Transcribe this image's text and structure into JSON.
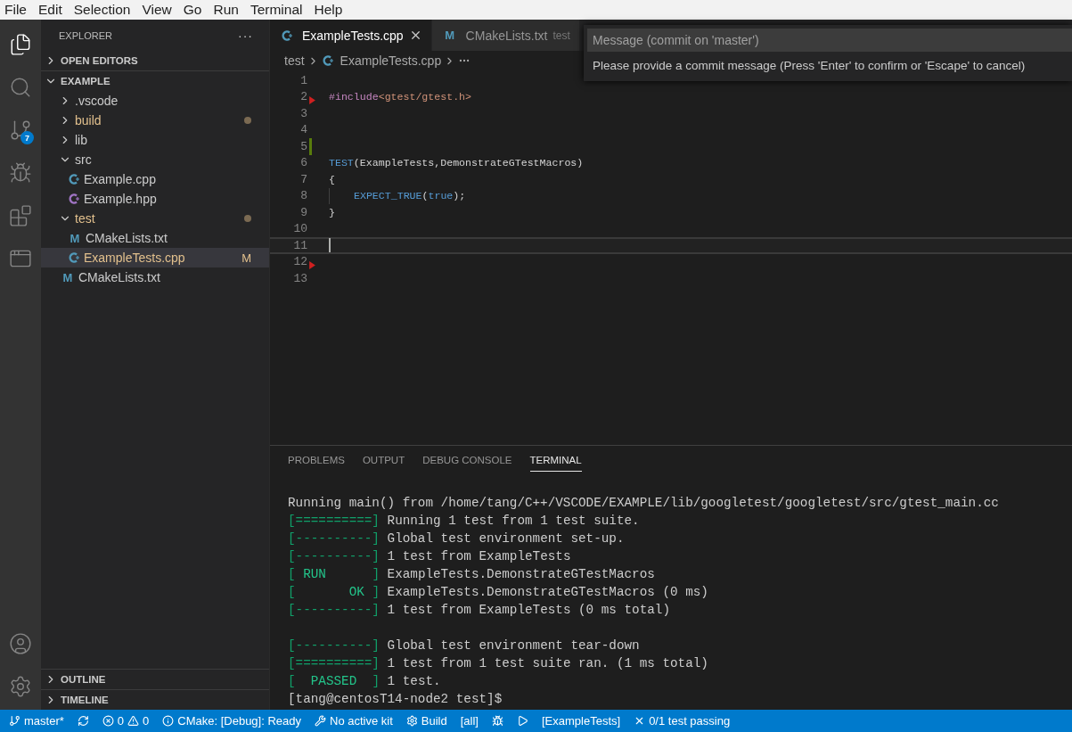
{
  "menu_bar": [
    "File",
    "Edit",
    "Selection",
    "View",
    "Go",
    "Run",
    "Terminal",
    "Help"
  ],
  "activity_bar": {
    "top": [
      {
        "kind": "files",
        "selected": true
      },
      {
        "kind": "search",
        "selected": false
      },
      {
        "kind": "source-control",
        "selected": false,
        "badge": "7"
      },
      {
        "kind": "run",
        "selected": false
      },
      {
        "kind": "extensions",
        "selected": false
      },
      {
        "kind": "remote",
        "selected": false
      }
    ],
    "bottom": [
      {
        "kind": "account",
        "selected": false
      },
      {
        "kind": "settings",
        "selected": false
      }
    ]
  },
  "sidebar": {
    "title": "EXPLORER",
    "more": "···",
    "sections": [
      {
        "label": "OPEN EDITORS",
        "expanded": false
      }
    ],
    "folder": {
      "label": "EXAMPLE",
      "expanded": true,
      "items": [
        {
          "kind": "folder",
          "label": ".vscode",
          "expanded": false,
          "modified": false,
          "selected": false
        },
        {
          "kind": "folder",
          "label": "build",
          "expanded": false,
          "modified": true,
          "selected": false
        },
        {
          "kind": "folder",
          "label": "lib",
          "expanded": false,
          "modified": false,
          "selected": false
        },
        {
          "kind": "folder",
          "label": "src",
          "expanded": true,
          "modified": false,
          "selected": false,
          "children": [
            {
              "kind": "cpp",
              "label": "Example.cpp",
              "modified": false,
              "selected": false
            },
            {
              "kind": "hpp",
              "label": "Example.hpp",
              "modified": false,
              "selected": false
            }
          ]
        },
        {
          "kind": "folder",
          "label": "test",
          "expanded": true,
          "modified": true,
          "selected": false,
          "children": [
            {
              "kind": "cmake",
              "glyph": "M",
              "label": "CMakeLists.txt",
              "modified": false,
              "selected": false
            },
            {
              "kind": "cpp",
              "label": "ExampleTests.cpp",
              "modified": true,
              "badge": "M",
              "selected": true
            }
          ]
        },
        {
          "kind": "cmake",
          "glyph": "M",
          "label": "CMakeLists.txt",
          "modified": false,
          "selected": false
        }
      ]
    },
    "bottom_sections": [
      {
        "label": "OUTLINE",
        "expanded": false
      },
      {
        "label": "TIMELINE",
        "expanded": false
      }
    ]
  },
  "editor": {
    "tabs": [
      {
        "kind": "cpp",
        "label": "ExampleTests.cpp",
        "selected": true
      },
      {
        "kind": "cmake",
        "glyph": "M",
        "label": "CMakeLists.txt",
        "description": "test",
        "selected": false
      }
    ],
    "breadcrumb": {
      "folder": "test",
      "file": "ExampleTests.cpp"
    },
    "code": {
      "lines": [
        {
          "number": "1",
          "error": false,
          "modified": false,
          "current": false,
          "indented": false
        },
        {
          "number": "2",
          "tokens": [
            {
              "kind": "directive",
              "text": "#include"
            },
            {
              "kind": "string",
              "text": "<gtest/gtest.h>"
            }
          ],
          "error": true,
          "modified": false,
          "current": false,
          "indented": false
        },
        {
          "number": "3",
          "error": false,
          "modified": false,
          "current": false,
          "indented": false
        },
        {
          "number": "4",
          "error": false,
          "modified": false,
          "current": false,
          "indented": false
        },
        {
          "number": "5",
          "error": false,
          "modified": true,
          "current": false,
          "indented": false
        },
        {
          "number": "6",
          "tokens": [
            {
              "kind": "macro",
              "text": "TEST"
            },
            {
              "kind": "plain",
              "text": "(ExampleTests,DemonstrateGTestMacros)"
            }
          ],
          "error": false,
          "modified": false,
          "current": false,
          "indented": false
        },
        {
          "number": "7",
          "tokens": [
            {
              "kind": "plain",
              "text": "{"
            }
          ],
          "error": false,
          "modified": false,
          "current": false,
          "indented": false
        },
        {
          "number": "8",
          "tokens": [
            {
              "kind": "macro",
              "text": "EXPECT_TRUE"
            },
            {
              "kind": "plain",
              "text": "("
            },
            {
              "kind": "keyword",
              "text": "true"
            },
            {
              "kind": "plain",
              "text": ");"
            }
          ],
          "error": false,
          "modified": false,
          "current": false,
          "indented": true
        },
        {
          "number": "9",
          "tokens": [
            {
              "kind": "plain",
              "text": "}"
            }
          ],
          "error": false,
          "modified": false,
          "current": false,
          "indented": false
        },
        {
          "number": "10",
          "error": false,
          "modified": false,
          "current": false,
          "indented": false
        },
        {
          "number": "11",
          "error": false,
          "modified": false,
          "current": true,
          "indented": false
        },
        {
          "number": "12",
          "error": true,
          "modified": false,
          "current": false,
          "indented": false
        },
        {
          "number": "13",
          "error": false,
          "modified": false,
          "current": false,
          "indented": false
        }
      ]
    }
  },
  "quick_input": {
    "placeholder": "Message (commit on 'master')",
    "message": "Please provide a commit message (Press 'Enter' to confirm or 'Escape' to cancel)"
  },
  "panel": {
    "tabs": [
      {
        "label": "PROBLEMS",
        "selected": false
      },
      {
        "label": "OUTPUT",
        "selected": false
      },
      {
        "label": "DEBUG CONSOLE",
        "selected": false
      },
      {
        "label": "TERMINAL",
        "selected": true
      }
    ],
    "terminal": [
      {
        "kind": "output",
        "segments": [
          {
            "kind": "text",
            "text": "Running main() from /home/tang/C++/VSCODE/EXAMPLE/lib/googletest/googletest/src/gtest_main.cc"
          }
        ]
      },
      {
        "kind": "output",
        "segments": [
          {
            "kind": "bracket",
            "text": "[==========]"
          },
          {
            "kind": "text",
            "text": " Running 1 test from 1 test suite."
          }
        ]
      },
      {
        "kind": "output",
        "segments": [
          {
            "kind": "bracket",
            "text": "[----------]"
          },
          {
            "kind": "text",
            "text": " Global test environment set-up."
          }
        ]
      },
      {
        "kind": "output",
        "segments": [
          {
            "kind": "bracket",
            "text": "[----------]"
          },
          {
            "kind": "text",
            "text": " 1 test from ExampleTests"
          }
        ]
      },
      {
        "kind": "output",
        "segments": [
          {
            "kind": "bracket",
            "text": "["
          },
          {
            "kind": "status",
            "text": " RUN      "
          },
          {
            "kind": "bracket",
            "text": "]"
          },
          {
            "kind": "text",
            "text": " ExampleTests.DemonstrateGTestMacros"
          }
        ]
      },
      {
        "kind": "output",
        "segments": [
          {
            "kind": "bracket",
            "text": "["
          },
          {
            "kind": "status",
            "text": "       OK "
          },
          {
            "kind": "bracket",
            "text": "]"
          },
          {
            "kind": "text",
            "text": " ExampleTests.DemonstrateGTestMacros (0 ms)"
          }
        ]
      },
      {
        "kind": "output",
        "segments": [
          {
            "kind": "bracket",
            "text": "[----------]"
          },
          {
            "kind": "text",
            "text": " 1 test from ExampleTests (0 ms total)"
          }
        ]
      },
      {
        "kind": "blank"
      },
      {
        "kind": "output",
        "segments": [
          {
            "kind": "bracket",
            "text": "[----------]"
          },
          {
            "kind": "text",
            "text": " Global test environment tear-down"
          }
        ]
      },
      {
        "kind": "output",
        "segments": [
          {
            "kind": "bracket",
            "text": "[==========]"
          },
          {
            "kind": "text",
            "text": " 1 test from 1 test suite ran. (1 ms total)"
          }
        ]
      },
      {
        "kind": "output",
        "segments": [
          {
            "kind": "bracket",
            "text": "["
          },
          {
            "kind": "status",
            "text": "  PASSED  "
          },
          {
            "kind": "bracket",
            "text": "]"
          },
          {
            "kind": "text",
            "text": " 1 test."
          }
        ]
      },
      {
        "kind": "output",
        "segments": [
          {
            "kind": "text",
            "text": "[tang@centosT14-node2 test]$"
          }
        ]
      }
    ]
  },
  "status_bar": [
    {
      "kind": "branch",
      "text": "master*"
    },
    {
      "kind": "sync"
    },
    {
      "kind": "problems",
      "errors": "0",
      "warnings": "0"
    },
    {
      "kind": "info",
      "text": "CMake: [Debug]: Ready"
    },
    {
      "kind": "tools",
      "text": "No active kit"
    },
    {
      "kind": "gear",
      "text": "Build"
    },
    {
      "kind": "text",
      "text": "[all]"
    },
    {
      "kind": "debug"
    },
    {
      "kind": "play"
    },
    {
      "kind": "text",
      "text": "[ExampleTests]"
    },
    {
      "kind": "fail",
      "text": "0/1 test passing"
    }
  ]
}
